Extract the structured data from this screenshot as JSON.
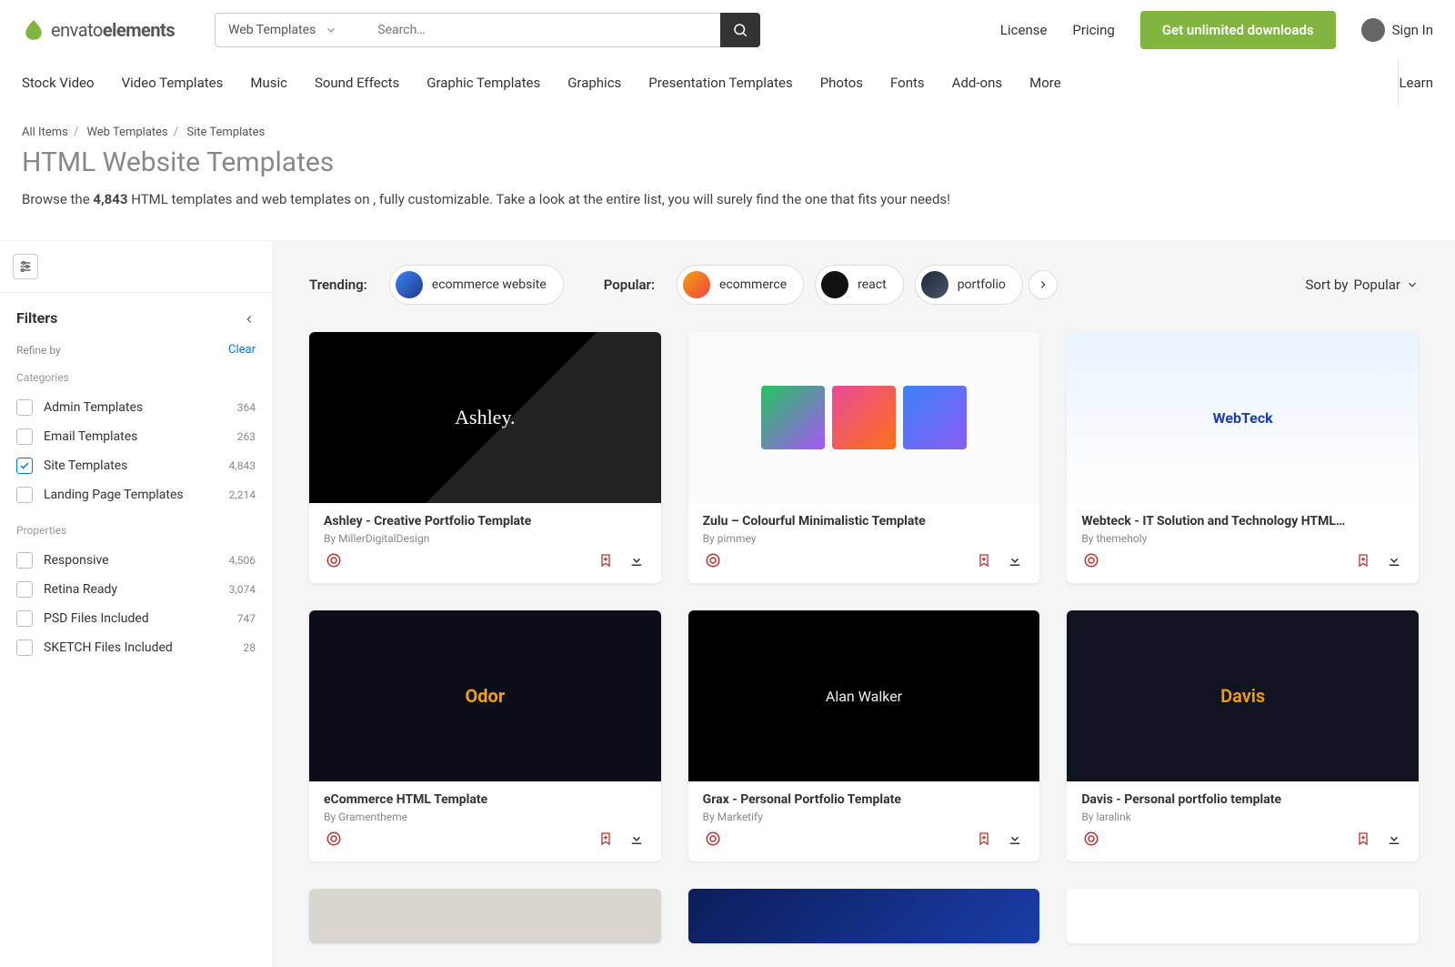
{
  "brand": {
    "name_prefix": "envato",
    "name_suffix": "elements"
  },
  "search": {
    "category_label": "Web Templates",
    "placeholder": "Search…"
  },
  "top_links": {
    "license": "License",
    "pricing": "Pricing",
    "cta": "Get unlimited downloads",
    "signin": "Sign In"
  },
  "nav": [
    "Stock Video",
    "Video Templates",
    "Music",
    "Sound Effects",
    "Graphic Templates",
    "Graphics",
    "Presentation Templates",
    "Photos",
    "Fonts",
    "Add-ons",
    "More"
  ],
  "learn_label": "Learn",
  "breadcrumbs": [
    {
      "label": "All Items",
      "href": true
    },
    {
      "label": "Web Templates",
      "href": true
    },
    {
      "label": "Site Templates",
      "href": false
    }
  ],
  "page": {
    "title": "HTML Website Templates",
    "sub_prefix": "Browse the ",
    "count": "4,843",
    "sub_suffix": " HTML templates and web templates on , fully customizable. Take a look at the entire list, you will surely find the one that fits your needs!"
  },
  "filters": {
    "heading": "Filters",
    "refine_label": "Refine by",
    "clear_label": "Clear",
    "sections": [
      {
        "label": "Categories",
        "items": [
          {
            "label": "Admin Templates",
            "count": "364",
            "checked": false
          },
          {
            "label": "Email Templates",
            "count": "263",
            "checked": false
          },
          {
            "label": "Site Templates",
            "count": "4,843",
            "checked": true
          },
          {
            "label": "Landing Page Templates",
            "count": "2,214",
            "checked": false
          }
        ]
      },
      {
        "label": "Properties",
        "items": [
          {
            "label": "Responsive",
            "count": "4,506",
            "checked": false
          },
          {
            "label": "Retina Ready",
            "count": "3,074",
            "checked": false
          },
          {
            "label": "PSD Files Included",
            "count": "747",
            "checked": false
          },
          {
            "label": "SKETCH Files Included",
            "count": "28",
            "checked": false
          }
        ]
      }
    ]
  },
  "pillrow": {
    "trending_label": "Trending:",
    "trending_pill": "ecommerce website",
    "popular_label": "Popular:",
    "popular_pills": [
      "ecommerce",
      "react",
      "portfolio"
    ]
  },
  "sort": {
    "prefix": "Sort by ",
    "value": "Popular"
  },
  "cards": [
    {
      "title": "Ashley - Creative Portfolio Template",
      "author": "By MillerDigitalDesign",
      "thumb_text": "Ashley."
    },
    {
      "title": "Zulu – Colourful Minimalistic Template",
      "author": "By pimmey",
      "thumb_text": ""
    },
    {
      "title": "Webteck - IT Solution and Technology HTML…",
      "author": "By themeholy",
      "thumb_text": "WebTeck"
    },
    {
      "title": "eCommerce HTML Template",
      "author": "By Gramentheme",
      "thumb_text": "Odor"
    },
    {
      "title": "Grax - Personal Portfolio Template",
      "author": "By Marketify",
      "thumb_text": "Alan Walker"
    },
    {
      "title": "Davis - Personal portfolio template",
      "author": "By laralink",
      "thumb_text": "Davis"
    }
  ]
}
